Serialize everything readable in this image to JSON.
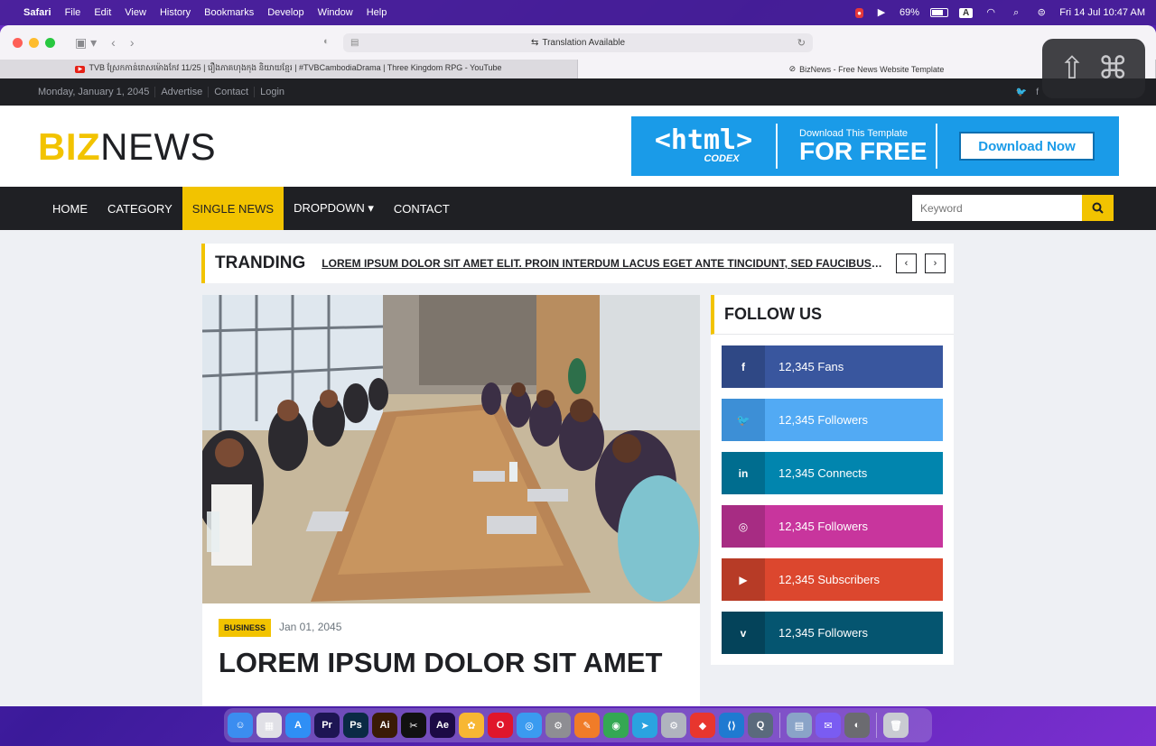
{
  "menubar": {
    "app_name": "Safari",
    "items": [
      "File",
      "Edit",
      "View",
      "History",
      "Bookmarks",
      "Develop",
      "Window",
      "Help"
    ],
    "battery_percent": "69%",
    "input_source": "A",
    "datetime": "Fri 14 Jul  10:47 AM"
  },
  "browser": {
    "address_text": "Translation Available",
    "tabs": [
      {
        "title": "TVB ស្រែកកាន់រោសម៉ោងកែវ 11/25 | រឿងភាគហុងកុង និយាយខ្មែរ | #TVBCambodiaDrama | Three Kingdom RPG - YouTube",
        "active": false
      },
      {
        "title": "BizNews - Free News Website Template",
        "active": true
      }
    ]
  },
  "site": {
    "topbar": {
      "date": "Monday, January 1, 2045",
      "links": [
        "Advertise",
        "Contact",
        "Login"
      ]
    },
    "logo": {
      "part1": "BIZ",
      "part2": "NEWS"
    },
    "banner": {
      "html_text": "<html>",
      "codex_text": "CODEX",
      "small_text": "Download This Template",
      "big_text": "FOR FREE",
      "button_label": "Download Now"
    },
    "nav": {
      "items": [
        "HOME",
        "CATEGORY",
        "SINGLE NEWS",
        "DROPDOWN ▾",
        "CONTACT"
      ],
      "active": "SINGLE NEWS",
      "search_placeholder": "Keyword"
    },
    "trending": {
      "label": "TRANDING",
      "headline": "LOREM IPSUM DOLOR SIT AMET ELIT. PROIN INTERDUM LACUS EGET ANTE TINCIDUNT, SED FAUCIBUS NISL SODALES"
    },
    "article": {
      "category": "BUSINESS",
      "date": "Jan 01, 2045",
      "title": "LOREM IPSUM DOLOR SIT AMET"
    },
    "follow": {
      "heading": "FOLLOW US",
      "rows": [
        {
          "icon": "facebook-icon",
          "glyph": "f",
          "text": "12,345 Fans",
          "color": "#39569e",
          "dark": "#2f4885"
        },
        {
          "icon": "twitter-icon",
          "glyph": "🐦",
          "text": "12,345 Followers",
          "color": "#52aaf4",
          "dark": "#3d8fd6"
        },
        {
          "icon": "linkedin-icon",
          "glyph": "in",
          "text": "12,345 Connects",
          "color": "#0185ae",
          "dark": "#006d8f"
        },
        {
          "icon": "instagram-icon",
          "glyph": "◎",
          "text": "12,345 Followers",
          "color": "#c8359d",
          "dark": "#a72c83"
        },
        {
          "icon": "youtube-icon",
          "glyph": "▶",
          "text": "12,345 Subscribers",
          "color": "#dc472e",
          "dark": "#b73b26"
        },
        {
          "icon": "vimeo-icon",
          "glyph": "v",
          "text": "12,345 Followers",
          "color": "#055570",
          "dark": "#04435a"
        }
      ]
    }
  },
  "keycast": {
    "keys": [
      "⇧",
      "⌘"
    ]
  },
  "dock": {
    "apps": [
      {
        "name": "finder",
        "label": "☺",
        "color": "#3b8df0"
      },
      {
        "name": "launchpad",
        "label": "▦",
        "color": "#e0e0e6"
      },
      {
        "name": "app-store",
        "label": "A",
        "color": "#2f8ff5"
      },
      {
        "name": "premiere",
        "label": "Pr",
        "color": "#1d1553"
      },
      {
        "name": "photoshop",
        "label": "Ps",
        "color": "#0b2a45"
      },
      {
        "name": "illustrator",
        "label": "Ai",
        "color": "#3a1b06"
      },
      {
        "name": "capcut",
        "label": "✂",
        "color": "#111111"
      },
      {
        "name": "after-effects",
        "label": "Ae",
        "color": "#1c0a45"
      },
      {
        "name": "photos",
        "label": "✿",
        "color": "#f7b733"
      },
      {
        "name": "opera",
        "label": "O",
        "color": "#e0162b"
      },
      {
        "name": "safari",
        "label": "◎",
        "color": "#3a9bf0"
      },
      {
        "name": "system-settings",
        "label": "⚙",
        "color": "#8e8e93"
      },
      {
        "name": "pages",
        "label": "✎",
        "color": "#f07c28"
      },
      {
        "name": "chrome",
        "label": "◉",
        "color": "#34a853"
      },
      {
        "name": "telegram",
        "label": "➤",
        "color": "#2aa3e0"
      },
      {
        "name": "utility",
        "label": "⚙",
        "color": "#b0b4be"
      },
      {
        "name": "anydesk",
        "label": "◆",
        "color": "#e8362e"
      },
      {
        "name": "vscode",
        "label": "⟨⟩",
        "color": "#1f7ad1"
      },
      {
        "name": "quicktime",
        "label": "Q",
        "color": "#5a6a7c"
      },
      {
        "name": "preview",
        "label": "▤",
        "color": "#8aa4c8"
      },
      {
        "name": "messenger",
        "label": "✉",
        "color": "#7a5cf2"
      },
      {
        "name": "disk-utility",
        "label": "◐",
        "color": "#6b6b70"
      },
      {
        "name": "trash",
        "label": "🗑",
        "color": "#c9cbd2"
      }
    ]
  }
}
